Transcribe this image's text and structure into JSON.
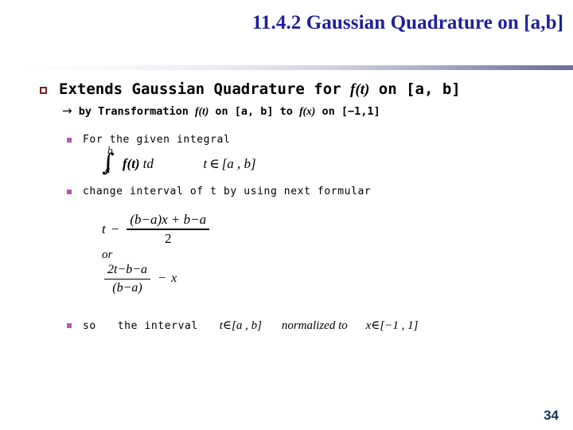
{
  "slide": {
    "title": "11.4.2 Gaussian Quadrature on [a,b]",
    "page_number": "34",
    "title_color": "#1f1f9c",
    "page_number_color": "#11365a",
    "bullet_level1_color": "#7c1f1f",
    "bullet_level2_color": "#b357b3"
  },
  "content": {
    "bullet1": {
      "text_before": "Extends Gaussian Quadrature for ",
      "math_ft": "f(t)",
      "text_after": " on [a, b]"
    },
    "subline": {
      "arrow": "→",
      "text1": " by Transformation ",
      "math_ft": "f(t)",
      "text2": " on [a, b] to ",
      "math_fx": "f(x)",
      "text3": " on [−1,1]"
    },
    "bullet2_label": "For the given integral",
    "equation1": {
      "integral_sign": "∫",
      "limit_upper": "b",
      "limit_lower": "a",
      "integrand": "f(t)",
      "differential": "td",
      "domain_var": "t",
      "element_of": "∈",
      "domain_interval": "[a , b]"
    },
    "bullet3_label": "change interval of t by using next formular",
    "equation2": {
      "lhs": "t",
      "relation": "−",
      "numerator": "(b−a)x + b−a",
      "denominator": "2"
    },
    "or_label": "or",
    "equation3": {
      "numerator": "2t−b−a",
      "denominator": "(b−a)",
      "relation": "−",
      "rhs": "x"
    },
    "bullet4": {
      "text1": "so",
      "text2": "the interval",
      "math_t": "t",
      "elem1": "∈",
      "interval_t": "[a , b]",
      "normalized": "normalized to",
      "math_x": "x",
      "elem2": "∈",
      "interval_x": "[−1 , 1]"
    }
  }
}
